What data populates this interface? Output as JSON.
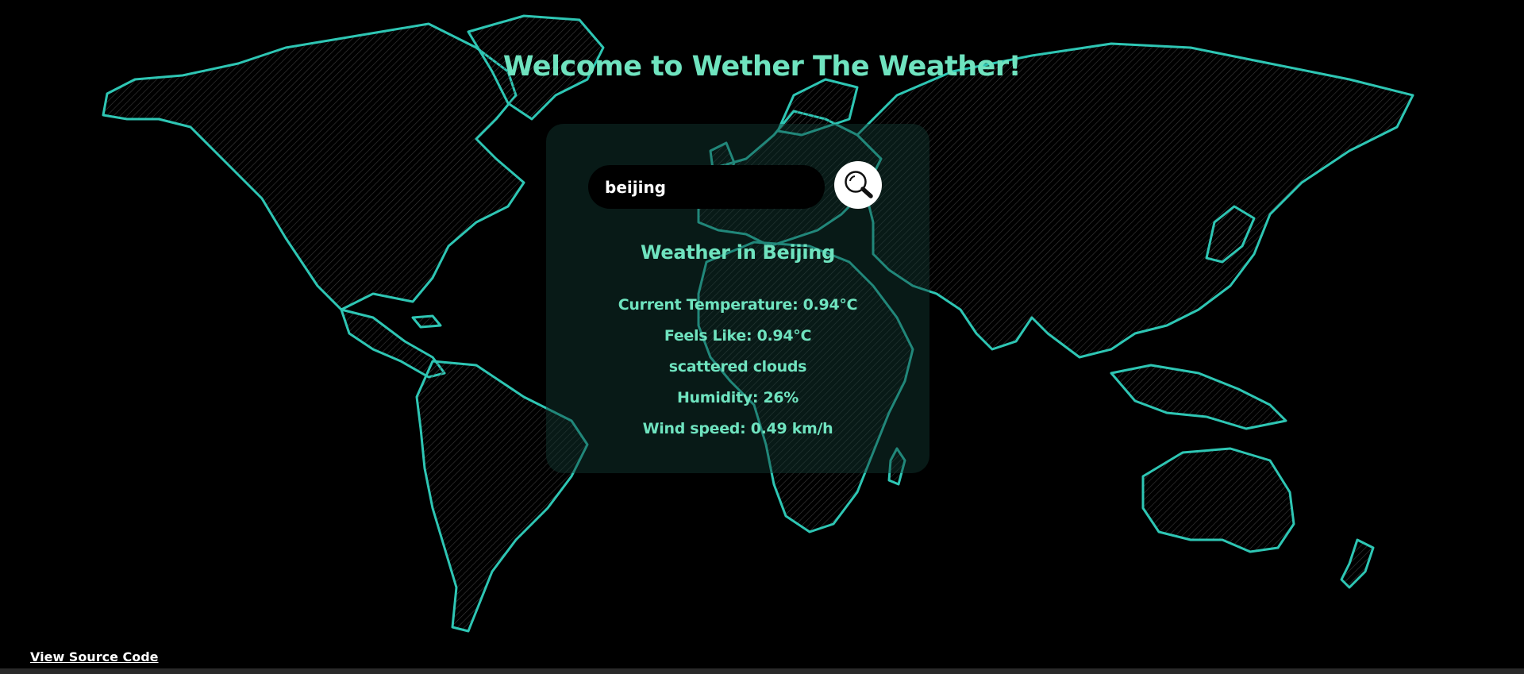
{
  "header": {
    "title": "Welcome to Wether The Weather!"
  },
  "search": {
    "value": "beijing",
    "button_icon": "magnifier-icon"
  },
  "weather": {
    "heading": "Weather in Beijing",
    "temperature": "Current Temperature: 0.94°C",
    "feels_like": "Feels Like: 0.94°C",
    "description": "scattered clouds",
    "humidity": "Humidity: 26%",
    "wind_speed": "Wind speed: 0.49 km/h"
  },
  "footer": {
    "source_link": "View Source Code"
  },
  "colors": {
    "accent": "#6fe3bf",
    "map_outline": "#2ec6b4",
    "background": "#000000"
  }
}
